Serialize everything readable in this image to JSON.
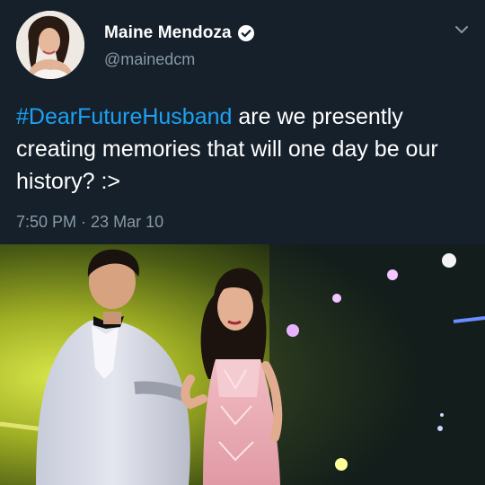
{
  "user": {
    "display_name": "Maine Mendoza",
    "handle": "@mainedcm",
    "verified": true,
    "avatar_icon": "profile-photo"
  },
  "tweet": {
    "hashtag": "#DearFutureHusband",
    "text": " are we presently creating memories that will one day be our history? :>",
    "time": "7:50 PM",
    "separator": " · ",
    "date": "23 Mar 10"
  },
  "icons": {
    "verified": "verified-badge-icon",
    "menu": "chevron-down-icon"
  },
  "colors": {
    "background": "#15202b",
    "text": "#ffffff",
    "secondary": "#8899a6",
    "link": "#1da1f2"
  }
}
